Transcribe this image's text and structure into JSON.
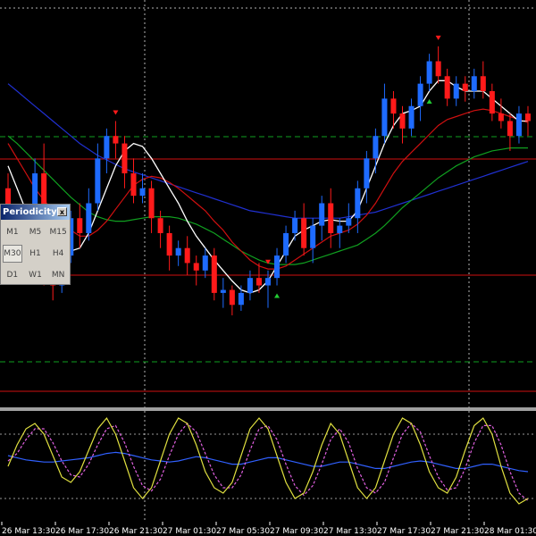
{
  "periodicity_panel": {
    "title": "Periodicity",
    "close_symbol": "x",
    "buttons": [
      "M1",
      "M5",
      "M15",
      "M30",
      "H1",
      "H4",
      "D1",
      "W1",
      "MN"
    ],
    "active": "M30"
  },
  "time_axis": {
    "labels": [
      "26 Mar 13:30",
      "26 Mar 17:30",
      "26 Mar 21:30",
      "27 Mar 01:30",
      "27 Mar 05:30",
      "27 Mar 09:30",
      "27 Mar 13:30",
      "27 Mar 17:30",
      "27 Mar 21:30",
      "28 Mar 01:30"
    ]
  },
  "colors": {
    "background": "#000000",
    "bull_candle": "#1e6bff",
    "bear_candle": "#ff1a1a",
    "neutral_candle": "#22cc33",
    "ma_fast": "#ffffff",
    "ma_mid": "#d01010",
    "ma_slow_green": "#10a020",
    "ma_long_blue": "#2030d0",
    "hline_red": "#d01010",
    "hline_green": "#10a020",
    "grid": "#ffffff",
    "stoch_main": "#e0e040",
    "stoch_signal": "#e060e0",
    "stoch_blue": "#3060ff"
  },
  "chart_data": {
    "type": "candlestick",
    "candles": [
      [
        140,
        110,
        150,
        100
      ],
      [
        110,
        90,
        120,
        85
      ],
      [
        90,
        110,
        115,
        80
      ],
      [
        110,
        150,
        160,
        105
      ],
      [
        150,
        85,
        170,
        75
      ],
      [
        85,
        75,
        95,
        65
      ],
      [
        75,
        95,
        100,
        70
      ],
      [
        95,
        120,
        125,
        90
      ],
      [
        120,
        110,
        130,
        100
      ],
      [
        110,
        130,
        140,
        105
      ],
      [
        130,
        160,
        170,
        125
      ],
      [
        160,
        175,
        180,
        150
      ],
      [
        175,
        170,
        185,
        160
      ],
      [
        170,
        150,
        175,
        140
      ],
      [
        150,
        135,
        160,
        130
      ],
      [
        135,
        140,
        150,
        130
      ],
      [
        140,
        120,
        145,
        110
      ],
      [
        120,
        110,
        125,
        100
      ],
      [
        110,
        95,
        115,
        85
      ],
      [
        95,
        100,
        105,
        88
      ],
      [
        100,
        90,
        108,
        82
      ],
      [
        90,
        85,
        95,
        75
      ],
      [
        85,
        95,
        100,
        80
      ],
      [
        95,
        70,
        100,
        65
      ],
      [
        70,
        72,
        80,
        60
      ],
      [
        72,
        62,
        75,
        55
      ],
      [
        62,
        70,
        75,
        58
      ],
      [
        70,
        80,
        85,
        65
      ],
      [
        80,
        75,
        90,
        70
      ],
      [
        75,
        80,
        85,
        60
      ],
      [
        80,
        95,
        100,
        75
      ],
      [
        95,
        110,
        115,
        90
      ],
      [
        110,
        120,
        125,
        105
      ],
      [
        120,
        100,
        130,
        95
      ],
      [
        100,
        115,
        120,
        90
      ],
      [
        115,
        130,
        135,
        105
      ],
      [
        130,
        110,
        140,
        100
      ],
      [
        110,
        115,
        120,
        100
      ],
      [
        115,
        120,
        130,
        110
      ],
      [
        120,
        140,
        145,
        110
      ],
      [
        140,
        160,
        165,
        130
      ],
      [
        160,
        175,
        180,
        150
      ],
      [
        175,
        200,
        210,
        170
      ],
      [
        200,
        190,
        205,
        180
      ],
      [
        190,
        180,
        195,
        170
      ],
      [
        180,
        195,
        200,
        175
      ],
      [
        195,
        210,
        215,
        185
      ],
      [
        210,
        225,
        230,
        205
      ],
      [
        225,
        215,
        235,
        210
      ],
      [
        215,
        200,
        220,
        195
      ],
      [
        200,
        210,
        215,
        195
      ],
      [
        210,
        205,
        215,
        198
      ],
      [
        205,
        215,
        220,
        200
      ],
      [
        215,
        205,
        225,
        200
      ],
      [
        205,
        190,
        210,
        185
      ],
      [
        190,
        185,
        200,
        180
      ],
      [
        185,
        175,
        190,
        165
      ],
      [
        175,
        190,
        195,
        170
      ],
      [
        190,
        185,
        195,
        175
      ]
    ],
    "ma_fast": [
      155,
      140,
      125,
      120,
      118,
      110,
      100,
      98,
      100,
      110,
      125,
      140,
      155,
      165,
      170,
      168,
      160,
      150,
      140,
      130,
      118,
      108,
      100,
      92,
      85,
      78,
      72,
      70,
      72,
      78,
      88,
      98,
      108,
      112,
      115,
      118,
      119,
      118,
      118,
      125,
      140,
      155,
      170,
      182,
      190,
      192,
      195,
      205,
      212,
      212,
      208,
      205,
      205,
      205,
      200,
      195,
      190,
      185,
      185
    ],
    "ma_mid": [
      170,
      160,
      150,
      140,
      132,
      125,
      118,
      112,
      108,
      108,
      112,
      118,
      126,
      134,
      142,
      146,
      148,
      147,
      144,
      140,
      135,
      130,
      125,
      118,
      112,
      104,
      98,
      92,
      88,
      86,
      86,
      88,
      92,
      96,
      100,
      104,
      108,
      110,
      112,
      116,
      122,
      130,
      140,
      150,
      158,
      164,
      170,
      176,
      182,
      186,
      188,
      190,
      192,
      193,
      192,
      190,
      188,
      186,
      184
    ],
    "ma_slow_green": [
      175,
      170,
      164,
      158,
      152,
      146,
      140,
      134,
      129,
      124,
      121,
      119,
      118,
      118,
      119,
      120,
      121,
      121,
      121,
      120,
      118,
      116,
      113,
      110,
      106,
      102,
      98,
      95,
      92,
      90,
      89,
      89,
      89,
      90,
      92,
      94,
      96,
      98,
      100,
      102,
      106,
      110,
      115,
      121,
      127,
      132,
      137,
      142,
      147,
      151,
      155,
      158,
      161,
      163,
      165,
      166,
      167,
      167,
      167
    ],
    "ma_long_blue": [
      210,
      205,
      200,
      195,
      190,
      185,
      180,
      175,
      170,
      166,
      162,
      159,
      156,
      153,
      151,
      149,
      147,
      145,
      143,
      141,
      139,
      137,
      135,
      133,
      131,
      129,
      127,
      125,
      124,
      123,
      122,
      121,
      120,
      120,
      120,
      120,
      120,
      120,
      121,
      122,
      123,
      124,
      126,
      128,
      130,
      132,
      134,
      136,
      138,
      140,
      142,
      144,
      146,
      148,
      150,
      152,
      154,
      156,
      158
    ],
    "stoch_main": [
      50,
      70,
      85,
      90,
      80,
      60,
      40,
      35,
      45,
      65,
      85,
      95,
      80,
      55,
      30,
      20,
      30,
      55,
      80,
      95,
      90,
      70,
      45,
      30,
      25,
      35,
      60,
      85,
      95,
      85,
      60,
      35,
      20,
      25,
      45,
      70,
      90,
      80,
      55,
      30,
      20,
      30,
      55,
      80,
      95,
      90,
      70,
      45,
      30,
      25,
      40,
      65,
      88,
      95,
      80,
      50,
      25,
      15,
      20
    ],
    "stoch_signal": [
      55,
      62,
      75,
      85,
      85,
      72,
      55,
      42,
      40,
      52,
      70,
      85,
      88,
      72,
      50,
      32,
      27,
      38,
      60,
      80,
      90,
      82,
      62,
      42,
      30,
      30,
      42,
      65,
      85,
      88,
      75,
      52,
      32,
      23,
      32,
      52,
      75,
      85,
      72,
      48,
      30,
      25,
      35,
      58,
      80,
      90,
      82,
      60,
      40,
      28,
      30,
      48,
      72,
      88,
      88,
      70,
      45,
      25,
      18
    ],
    "stoch_blue": [
      60,
      58,
      56,
      55,
      54,
      54,
      55,
      56,
      57,
      58,
      60,
      62,
      63,
      62,
      60,
      58,
      56,
      55,
      54,
      55,
      57,
      59,
      58,
      56,
      54,
      52,
      52,
      54,
      56,
      58,
      58,
      56,
      54,
      52,
      50,
      50,
      52,
      54,
      54,
      52,
      50,
      48,
      48,
      50,
      52,
      54,
      55,
      54,
      52,
      50,
      48,
      48,
      50,
      52,
      52,
      50,
      48,
      46,
      45
    ]
  }
}
